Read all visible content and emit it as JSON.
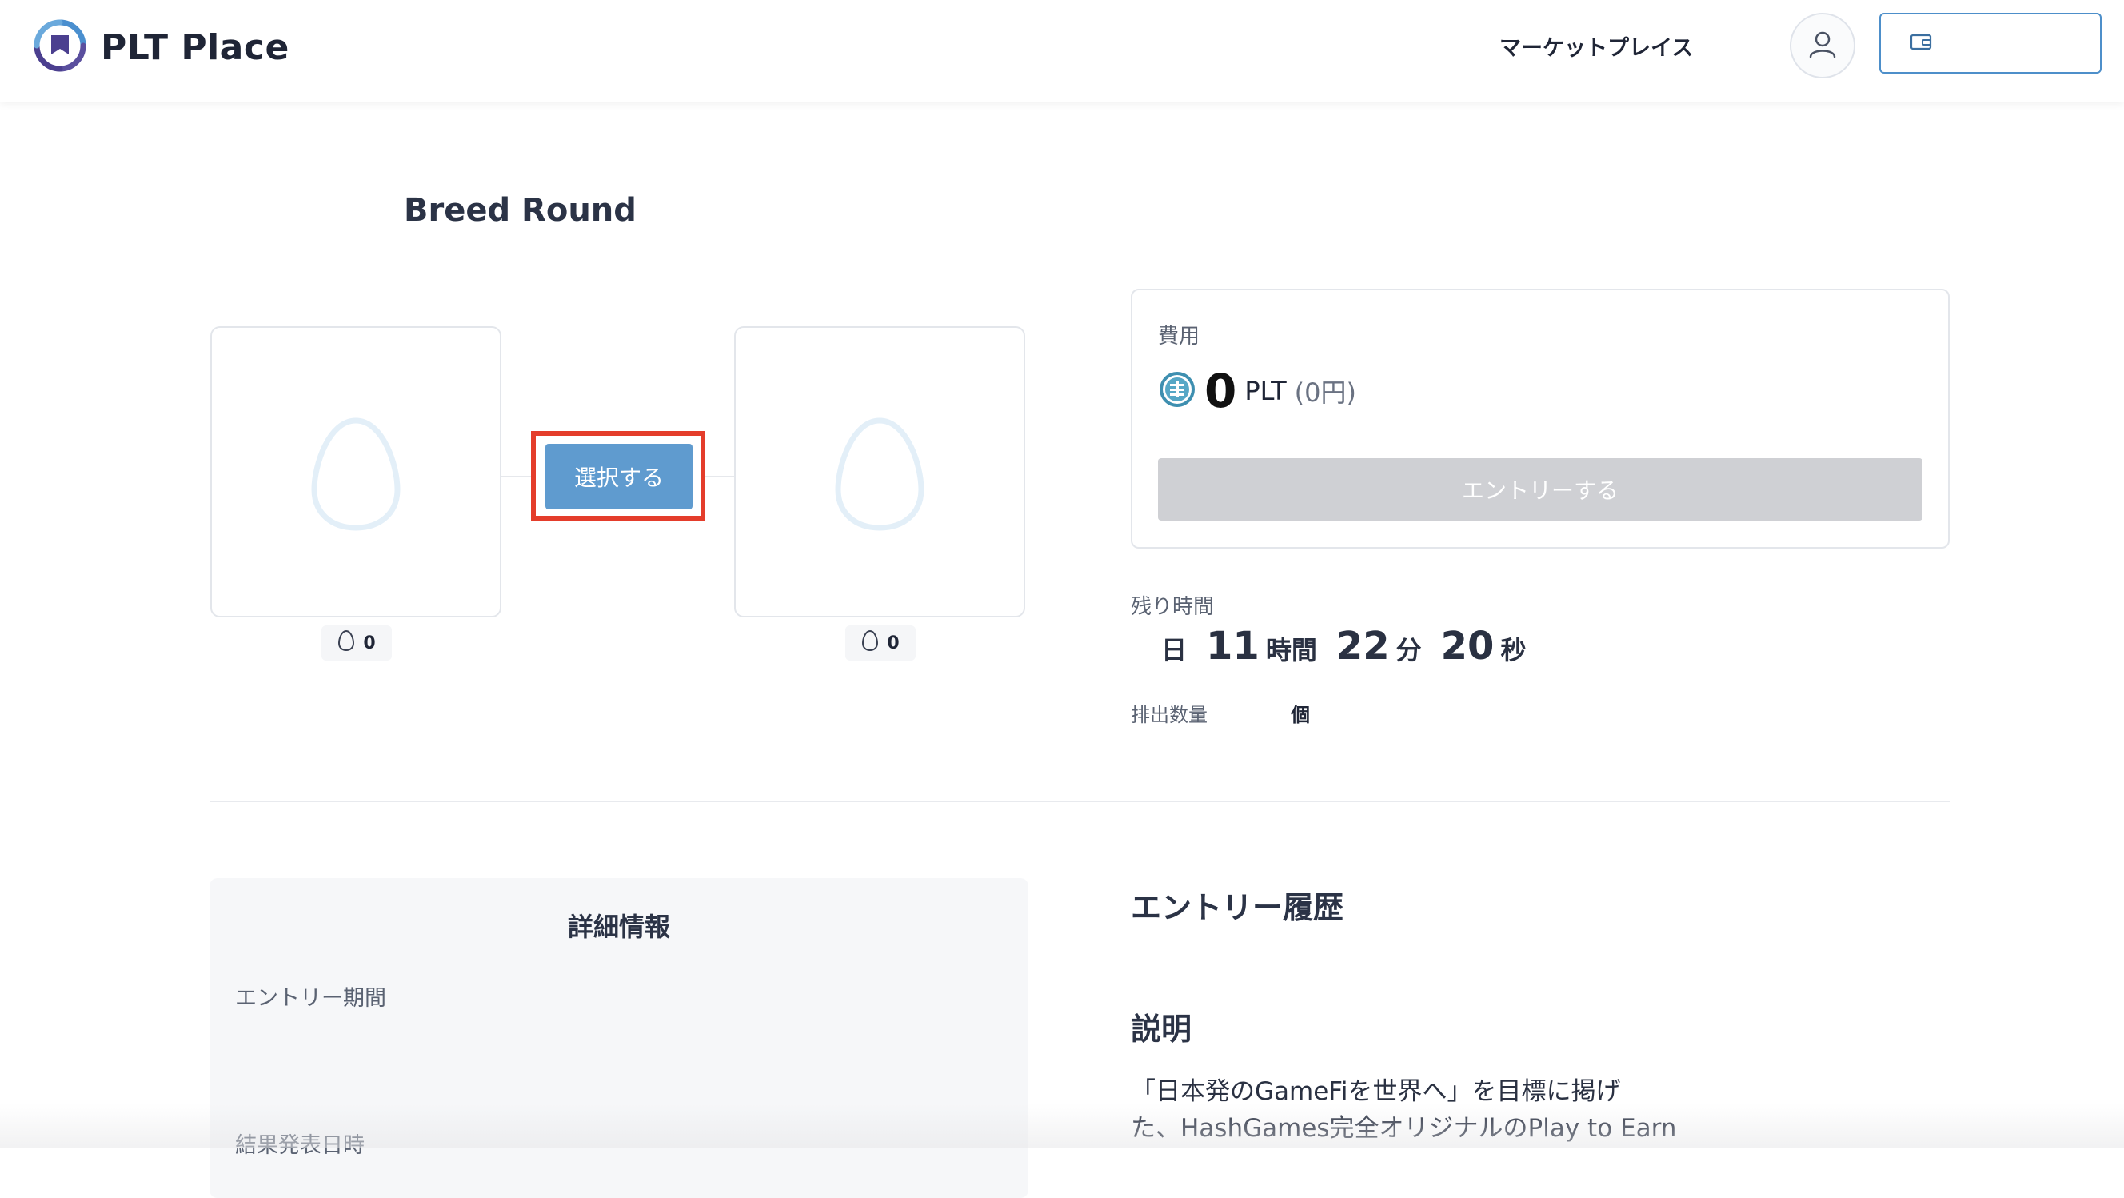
{
  "header": {
    "brand": "PLT Place",
    "nav_marketplace": "マーケットプレイス",
    "colors": {
      "brand_purple": "#4b3f8f",
      "brand_blue": "#4a8fcf",
      "wallet_border": "#4d8fca"
    },
    "icons": [
      "plt-place-logo",
      "user-icon",
      "wallet-icon"
    ]
  },
  "breed": {
    "title": "Breed Round",
    "left_egg_count": "0",
    "right_egg_count": "0",
    "select_button": "選択する",
    "icons": [
      "egg-icon"
    ]
  },
  "cost": {
    "label": "費用",
    "amount": "0",
    "unit": "PLT",
    "yen": "(0円)",
    "entry_button": "エントリーする",
    "icons": [
      "plt-coin-icon"
    ]
  },
  "countdown": {
    "label": "残り時間",
    "day_unit": "日",
    "hours": "11",
    "hour_unit": "時間",
    "minutes": "22",
    "minute_unit": "分",
    "seconds": "20",
    "second_unit": "秒"
  },
  "emission": {
    "label": "排出数量",
    "unit": "個"
  },
  "details": {
    "title": "詳細情報",
    "entry_period": "エントリー期間",
    "result_date": "結果発表日時"
  },
  "history": {
    "title": "エントリー履歴"
  },
  "description": {
    "title": "説明",
    "line1": "「日本発のGameFiを世界へ」を目標に掲げ",
    "line2": "た、HashGames完全オリジナルのPlay to Earn"
  }
}
